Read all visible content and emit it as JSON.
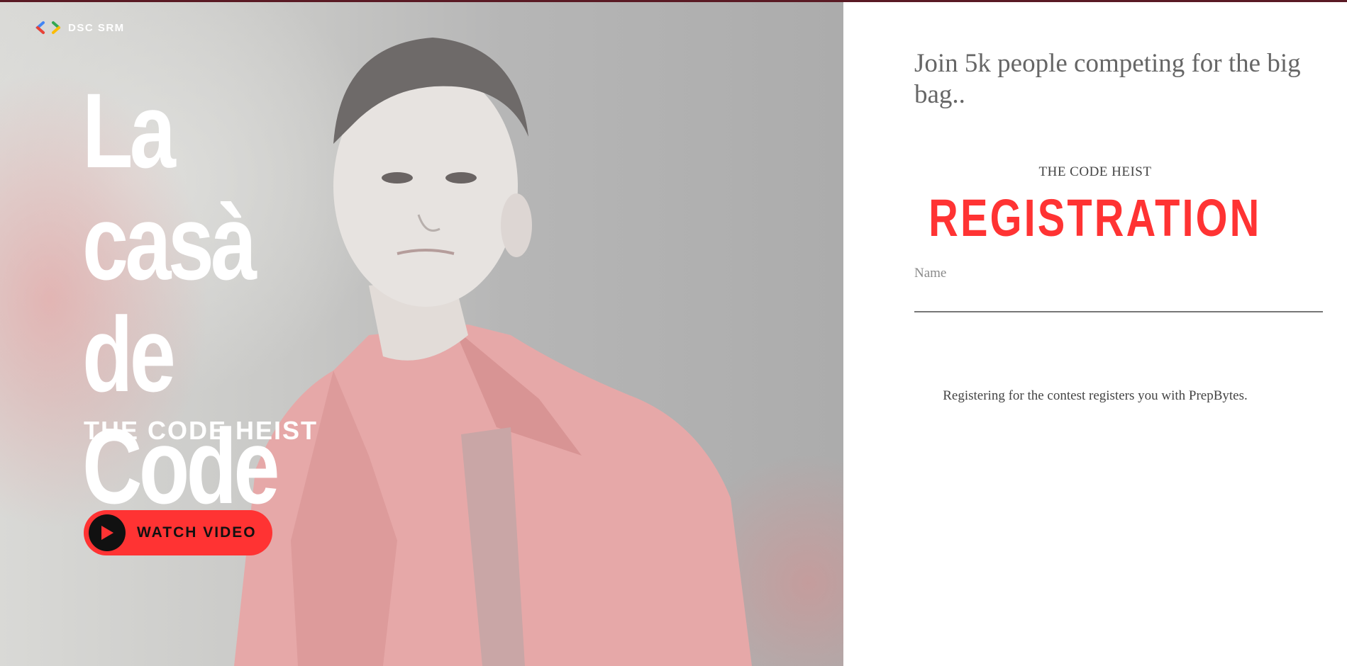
{
  "brand": {
    "name": "DSC SRM",
    "logo_icon": "dsc-brackets-icon"
  },
  "hero": {
    "title_lines": [
      "La",
      "casà de",
      "Code"
    ],
    "subtitle": "THE CODE HEIST",
    "watch_button": {
      "label": "WATCH VIDEO",
      "icon": "play-icon"
    }
  },
  "panel": {
    "tagline": "Join 5k people competing for the big bag..",
    "kicker": "THE CODE HEIST",
    "heading": "REGISTRATION",
    "name_field": {
      "placeholder": "Name",
      "value": ""
    },
    "note": "Registering for the contest registers you with PrepBytes."
  },
  "colors": {
    "accent": "#ff3333",
    "top_bar": "#5a1a24",
    "panel_bg": "#ffffff",
    "hero_text": "#ffffff"
  }
}
